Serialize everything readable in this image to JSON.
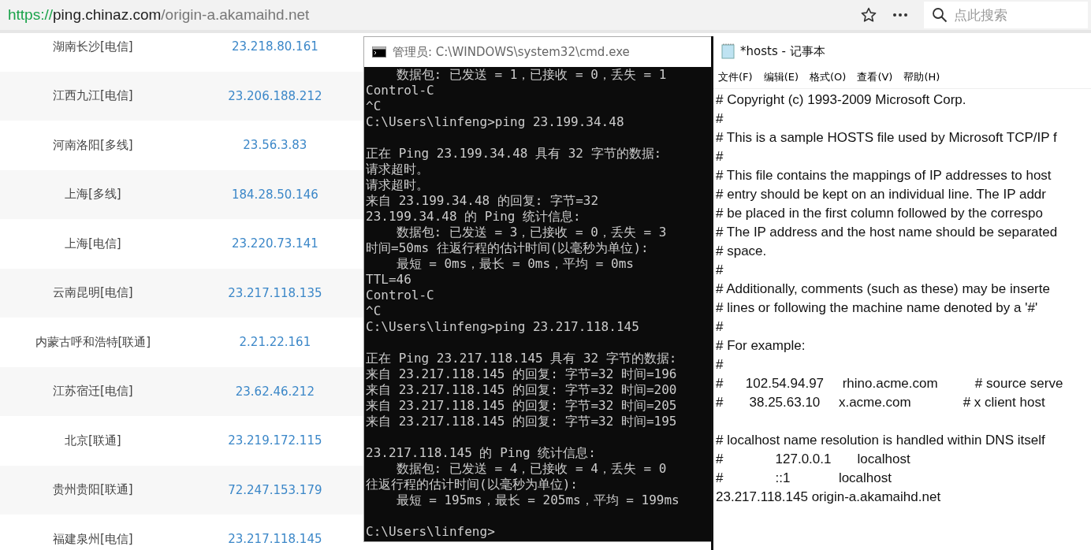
{
  "address_bar": {
    "scheme": "https://",
    "host": "ping.chinaz.com",
    "path": "/origin-a.akamaihd.net"
  },
  "search": {
    "placeholder": "点此搜索"
  },
  "results": [
    {
      "location": "湖南长沙[电信]",
      "ip": "23.218.80.161"
    },
    {
      "location": "江西九江[电信]",
      "ip": "23.206.188.212"
    },
    {
      "location": "河南洛阳[多线]",
      "ip": "23.56.3.83"
    },
    {
      "location": "上海[多线]",
      "ip": "184.28.50.146"
    },
    {
      "location": "上海[电信]",
      "ip": "23.220.73.141"
    },
    {
      "location": "云南昆明[电信]",
      "ip": "23.217.118.135"
    },
    {
      "location": "内蒙古呼和浩特[联通]",
      "ip": "2.21.22.161"
    },
    {
      "location": "江苏宿迁[电信]",
      "ip": "23.62.46.212"
    },
    {
      "location": "北京[联通]",
      "ip": "23.219.172.115"
    },
    {
      "location": "贵州贵阳[联通]",
      "ip": "72.247.153.179"
    },
    {
      "location": "福建泉州[电信]",
      "ip": "23.217.118.145"
    }
  ],
  "cmd_window": {
    "title": "管理员: C:\\WINDOWS\\system32\\cmd.exe",
    "blocks": [
      [
        "    数据包: 已发送 = 1，已接收 = 0，丢失 = 1",
        "Control-C",
        "^C",
        "C:\\Users\\linfeng>ping 23.199.34.48"
      ],
      [
        "正在 Ping 23.199.34.48 具有 32 字节的数据:",
        "请求超时。",
        "请求超时。",
        "来自 23.199.34.48 的回复: 字节=32",
        "23.199.34.48 的 Ping 统计信息:",
        "    数据包: 已发送 = 3，已接收 = 0，丢失 = 3",
        "时间=50ms 往返行程的估计时间(以毫秒为单位):",
        "    最短 = 0ms，最长 = 0ms，平均 = 0ms",
        "TTL=46",
        "Control-C",
        "^C",
        "C:\\Users\\linfeng>ping 23.217.118.145"
      ],
      [
        "正在 Ping 23.217.118.145 具有 32 字节的数据:",
        "来自 23.217.118.145 的回复: 字节=32 时间=196",
        "来自 23.217.118.145 的回复: 字节=32 时间=200",
        "来自 23.217.118.145 的回复: 字节=32 时间=205",
        "来自 23.217.118.145 的回复: 字节=32 时间=195"
      ],
      [
        "23.217.118.145 的 Ping 统计信息:",
        "    数据包: 已发送 = 4，已接收 = 4，丢失 = 0",
        "往返行程的估计时间(以毫秒为单位):",
        "    最短 = 195ms，最长 = 205ms，平均 = 199ms"
      ],
      [
        "C:\\Users\\linfeng>"
      ]
    ]
  },
  "notepad_window": {
    "title": "*hosts - 记事本",
    "menu": [
      "文件(F)",
      "编辑(E)",
      "格式(O)",
      "查看(V)",
      "帮助(H)"
    ],
    "blocks": [
      [
        "# Copyright (c) 1993-2009 Microsoft Corp.",
        "#",
        "# This is a sample HOSTS file used by Microsoft TCP/IP f",
        "#",
        "# This file contains the mappings of IP addresses to host",
        "# entry should be kept on an individual line. The IP addr",
        "# be placed in the first column followed by the correspo",
        "# The IP address and the host name should be separated",
        "# space.",
        "#",
        "# Additionally, comments (such as these) may be inserte",
        "# lines or following the machine name denoted by a '#'",
        "#",
        "# For example:",
        "#",
        "#      102.54.94.97     rhino.acme.com          # source serve",
        "#       38.25.63.10     x.acme.com              # x client host"
      ],
      [
        "# localhost name resolution is handled within DNS itself",
        "#              127.0.0.1       localhost",
        "#              ::1             localhost",
        "23.217.118.145 origin-a.akamaihd.net"
      ]
    ]
  }
}
